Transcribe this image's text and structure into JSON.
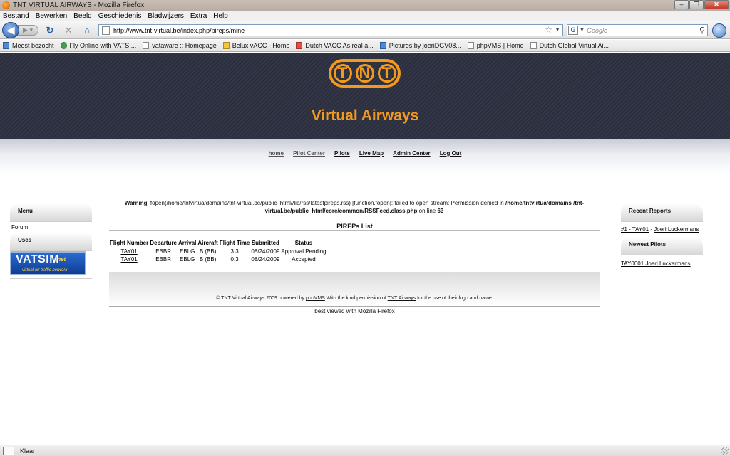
{
  "window": {
    "title": "TNT VIRTUAL AIRWAYS - Mozilla Firefox",
    "buttons": [
      "minimize",
      "maximize",
      "close"
    ]
  },
  "menu": [
    "Bestand",
    "Bewerken",
    "Beeld",
    "Geschiedenis",
    "Bladwijzers",
    "Extra",
    "Help"
  ],
  "navbar": {
    "url": "http://www.tnt-virtual.be/index.php/pireps/mine",
    "search_placeholder": "Google",
    "search_engine_letter": "G"
  },
  "bookmarks": [
    {
      "label": "Meest bezocht",
      "icon": "c1"
    },
    {
      "label": "Fly Online with VATSI...",
      "icon": "c2"
    },
    {
      "label": "vataware :: Homepage",
      "icon": ""
    },
    {
      "label": "Belux vACC - Home",
      "icon": "c3"
    },
    {
      "label": "Dutch VACC  As real a...",
      "icon": "c4"
    },
    {
      "label": "Pictures by joeriDGV08...",
      "icon": "c1"
    },
    {
      "label": "phpVMS | Home",
      "icon": ""
    },
    {
      "label": "Dutch Global Virtual Ai...",
      "icon": ""
    }
  ],
  "site": {
    "logo_letters": [
      "T",
      "N",
      "T"
    ],
    "brand": "Virtual Airways",
    "nav": [
      "home",
      "Pilot Center",
      "Pilots",
      "Live Map",
      "Admin Center",
      "Log Out"
    ]
  },
  "left_sidebar": {
    "menu_title": "Menu",
    "forum": "Forum",
    "uses_title": "Uses",
    "vatsim_main": "VATSIM",
    "vatsim_net": ".net",
    "vatsim_tagline": "virtual air traffic network"
  },
  "right_sidebar": {
    "recent_title": "Recent Reports",
    "recent_link": "#1 - TAY01",
    "recent_sep": " - ",
    "recent_pilot": "Joeri Luckermans",
    "newest_title": "Newest Pilots",
    "newest_pilot": "TAY0001 Joeri Luckermans"
  },
  "warning": {
    "label": "Warning",
    "text1": ": fopen(/home/tntvirtua/domains/tnt-virtual.be/public_html//lib/rss/latestpireps.rss) ",
    "func": "[function.fopen]",
    "text2": ": failed to open stream: Permission denied in ",
    "path": "/home/tntvirtua/domains /tnt-virtual.be/public_html/core/common/RSSFeed.class.php",
    "text3": " on line ",
    "line": "63"
  },
  "pireps": {
    "title": "PIREPs List",
    "headers": [
      "Flight Number",
      "Departure",
      "Arrival",
      "Aircraft",
      "Flight Time",
      "Submitted",
      "Status"
    ],
    "rows": [
      [
        "TAY01",
        "EBBR",
        "EBLG",
        "B (BB)",
        "3.3",
        "08/24/2009",
        "Approval Pending"
      ],
      [
        "TAY01",
        "EBBR",
        "EBLG",
        "B (BB)",
        "0.3",
        "08/24/2009",
        "Accepted"
      ]
    ]
  },
  "footer": {
    "text1": "© TNT Virtual Airways 2009 powered by ",
    "phpvms": "phpVMS",
    "text2": " With the kind permission of ",
    "tnt": "TNT Airways",
    "text3": " for the use of their logo and name.",
    "best1": "best viewed with ",
    "best_link": "Mozilla Firefox"
  },
  "status": {
    "text": "Klaar"
  }
}
